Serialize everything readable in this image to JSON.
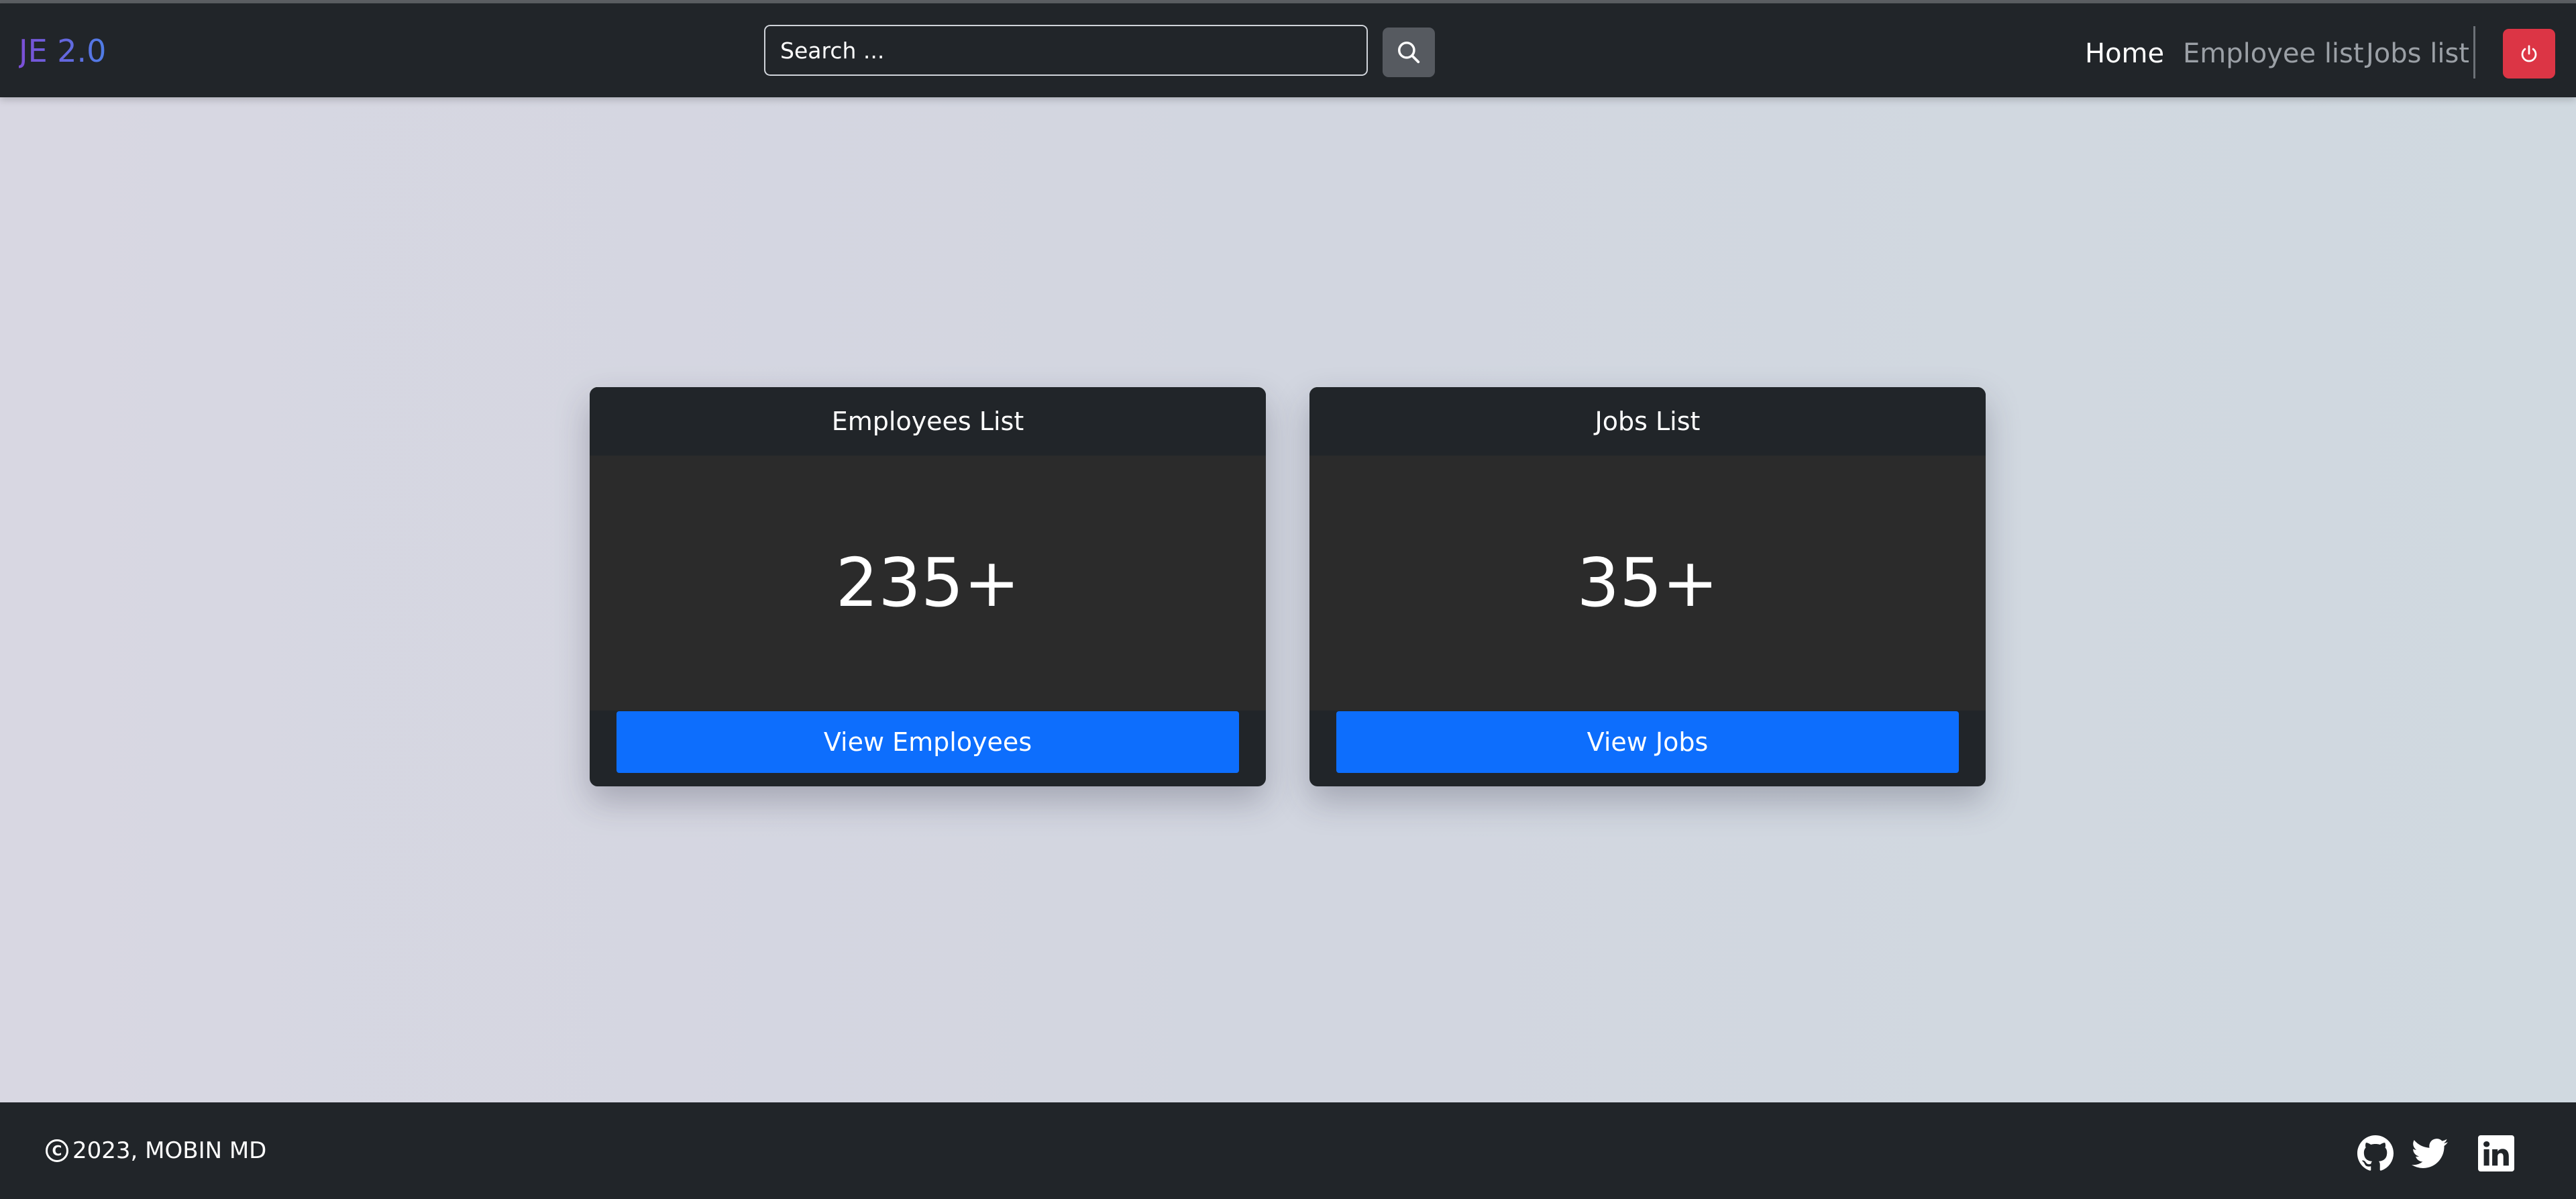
{
  "navbar": {
    "brand": "JE 2.0",
    "search_placeholder": "Search ...",
    "search_icon": "search-icon",
    "links": [
      {
        "label": "Home",
        "active": true
      },
      {
        "label": "Employee list",
        "active": false
      },
      {
        "label": "Jobs list",
        "active": false
      }
    ],
    "power_icon": "power-icon"
  },
  "cards": [
    {
      "title": "Employees List",
      "count": "235+",
      "button": "View Employees"
    },
    {
      "title": "Jobs List",
      "count": "35+",
      "button": "View Jobs"
    }
  ],
  "footer": {
    "copyright_symbol": "C",
    "copyright": "2023, MOBIN MD",
    "social_icons": [
      "github-icon",
      "twitter-icon",
      "linkedin-icon"
    ]
  },
  "colors": {
    "navbar_bg": "#212529",
    "primary_button": "#0d6efd",
    "danger_button": "#dc3545",
    "card_body": "#2b2b2b"
  }
}
